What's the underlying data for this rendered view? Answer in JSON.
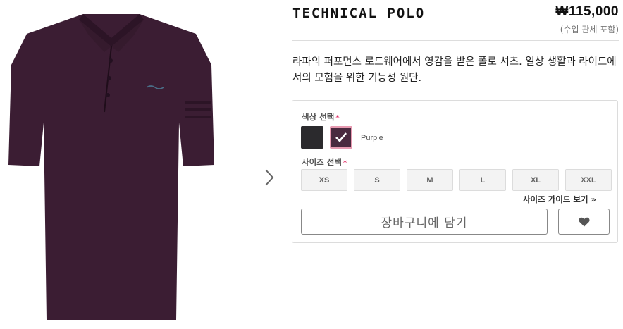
{
  "product": {
    "title": "TECHNICAL POLO",
    "price": "₩115,000",
    "price_note": "(수입 관세 포함)",
    "description": "라파의 퍼포먼스 로드웨어에서 영감을 받은 폴로 셔츠. 일상 생활과 라이드에서의 모험을 위한 기능성 원단.",
    "image_icon": "polo-shirt-image",
    "shirt_color": "#3b1d33"
  },
  "gallery": {
    "next_icon": "chevron-right-icon"
  },
  "options": {
    "color_label": "색상 선택",
    "required_mark": "*",
    "colors": [
      {
        "name": "Black",
        "hex": "#2b2a2d",
        "selected": false
      },
      {
        "name": "Purple",
        "hex": "#4a2a3f",
        "selected": true
      }
    ],
    "selected_color_name": "Purple",
    "size_label": "사이즈 선택",
    "sizes": [
      "XS",
      "S",
      "M",
      "L",
      "XL",
      "XXL"
    ],
    "size_guide": "사이즈 가이드 보기 »"
  },
  "actions": {
    "add_to_cart": "장바구니에 담기",
    "wishlist_icon": "heart-icon"
  },
  "colors": {
    "accent_pink": "#e79ab1",
    "required_red": "#e0245e"
  }
}
